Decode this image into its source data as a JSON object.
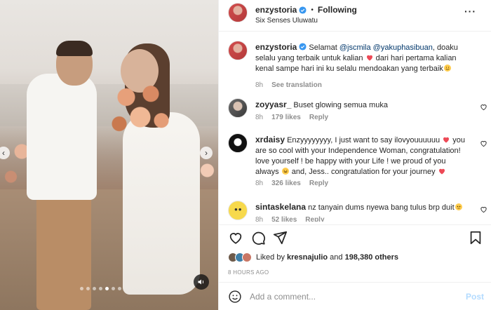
{
  "post": {
    "media_slide_count": 7,
    "media_active_slide": 5
  },
  "header": {
    "username": "enzystoria",
    "separator": "•",
    "follow_state": "Following",
    "location": "Six Senses Uluwatu",
    "more": "···"
  },
  "caption": {
    "username": "enzystoria",
    "text_1": " Selamat ",
    "mention_1": "@jscmila",
    "text_2": " ",
    "mention_2": "@yakuphasibuan",
    "text_3": ", doaku selalu yang terbaik untuk kalian ",
    "text_4": " dari hari pertama kalian kenal sampe hari ini ku selalu mendoakan yang terbaik",
    "time": "8h",
    "see_translation": "See translation"
  },
  "comments": [
    {
      "username": "zoyyasr_",
      "text": " Buset glowing semua muka",
      "time": "8h",
      "likes": "179 likes",
      "reply": "Reply"
    },
    {
      "username": "xrdaisy",
      "text_1": " Enzyyyyyyyy, I just want to say ilovyouuuuuu ",
      "text_2": " you are so cool with your Independence Woman, congratulation! love yourself ! be happy with your Life ! we proud of you always ",
      "text_3": " and, Jess.. congratulation for your journey ",
      "time": "8h",
      "likes": "326 likes",
      "reply": "Reply"
    },
    {
      "username": "sintaskelana",
      "text": " nz tanyain dums nyewa bang tulus brp duit",
      "time": "8h",
      "likes": "52 likes",
      "reply": "Reply"
    }
  ],
  "likes": {
    "prefix": "Liked by ",
    "user": "kresnajulio",
    "middle": " and ",
    "count": "198,380 others"
  },
  "time_ago": "8 HOURS AGO",
  "add_comment": {
    "placeholder": "Add a comment...",
    "post_label": "Post"
  },
  "icons": {
    "like": "heart-icon",
    "comment": "comment-icon",
    "share": "share-icon",
    "save": "bookmark-icon",
    "emoji": "smile-icon",
    "audio": "speaker-icon"
  },
  "colors": {
    "verified": "#3897f0",
    "heart_red": "#ed4956",
    "link": "#00376b",
    "secondary": "#8e8e8e",
    "post_disabled": "#b3dbff"
  }
}
